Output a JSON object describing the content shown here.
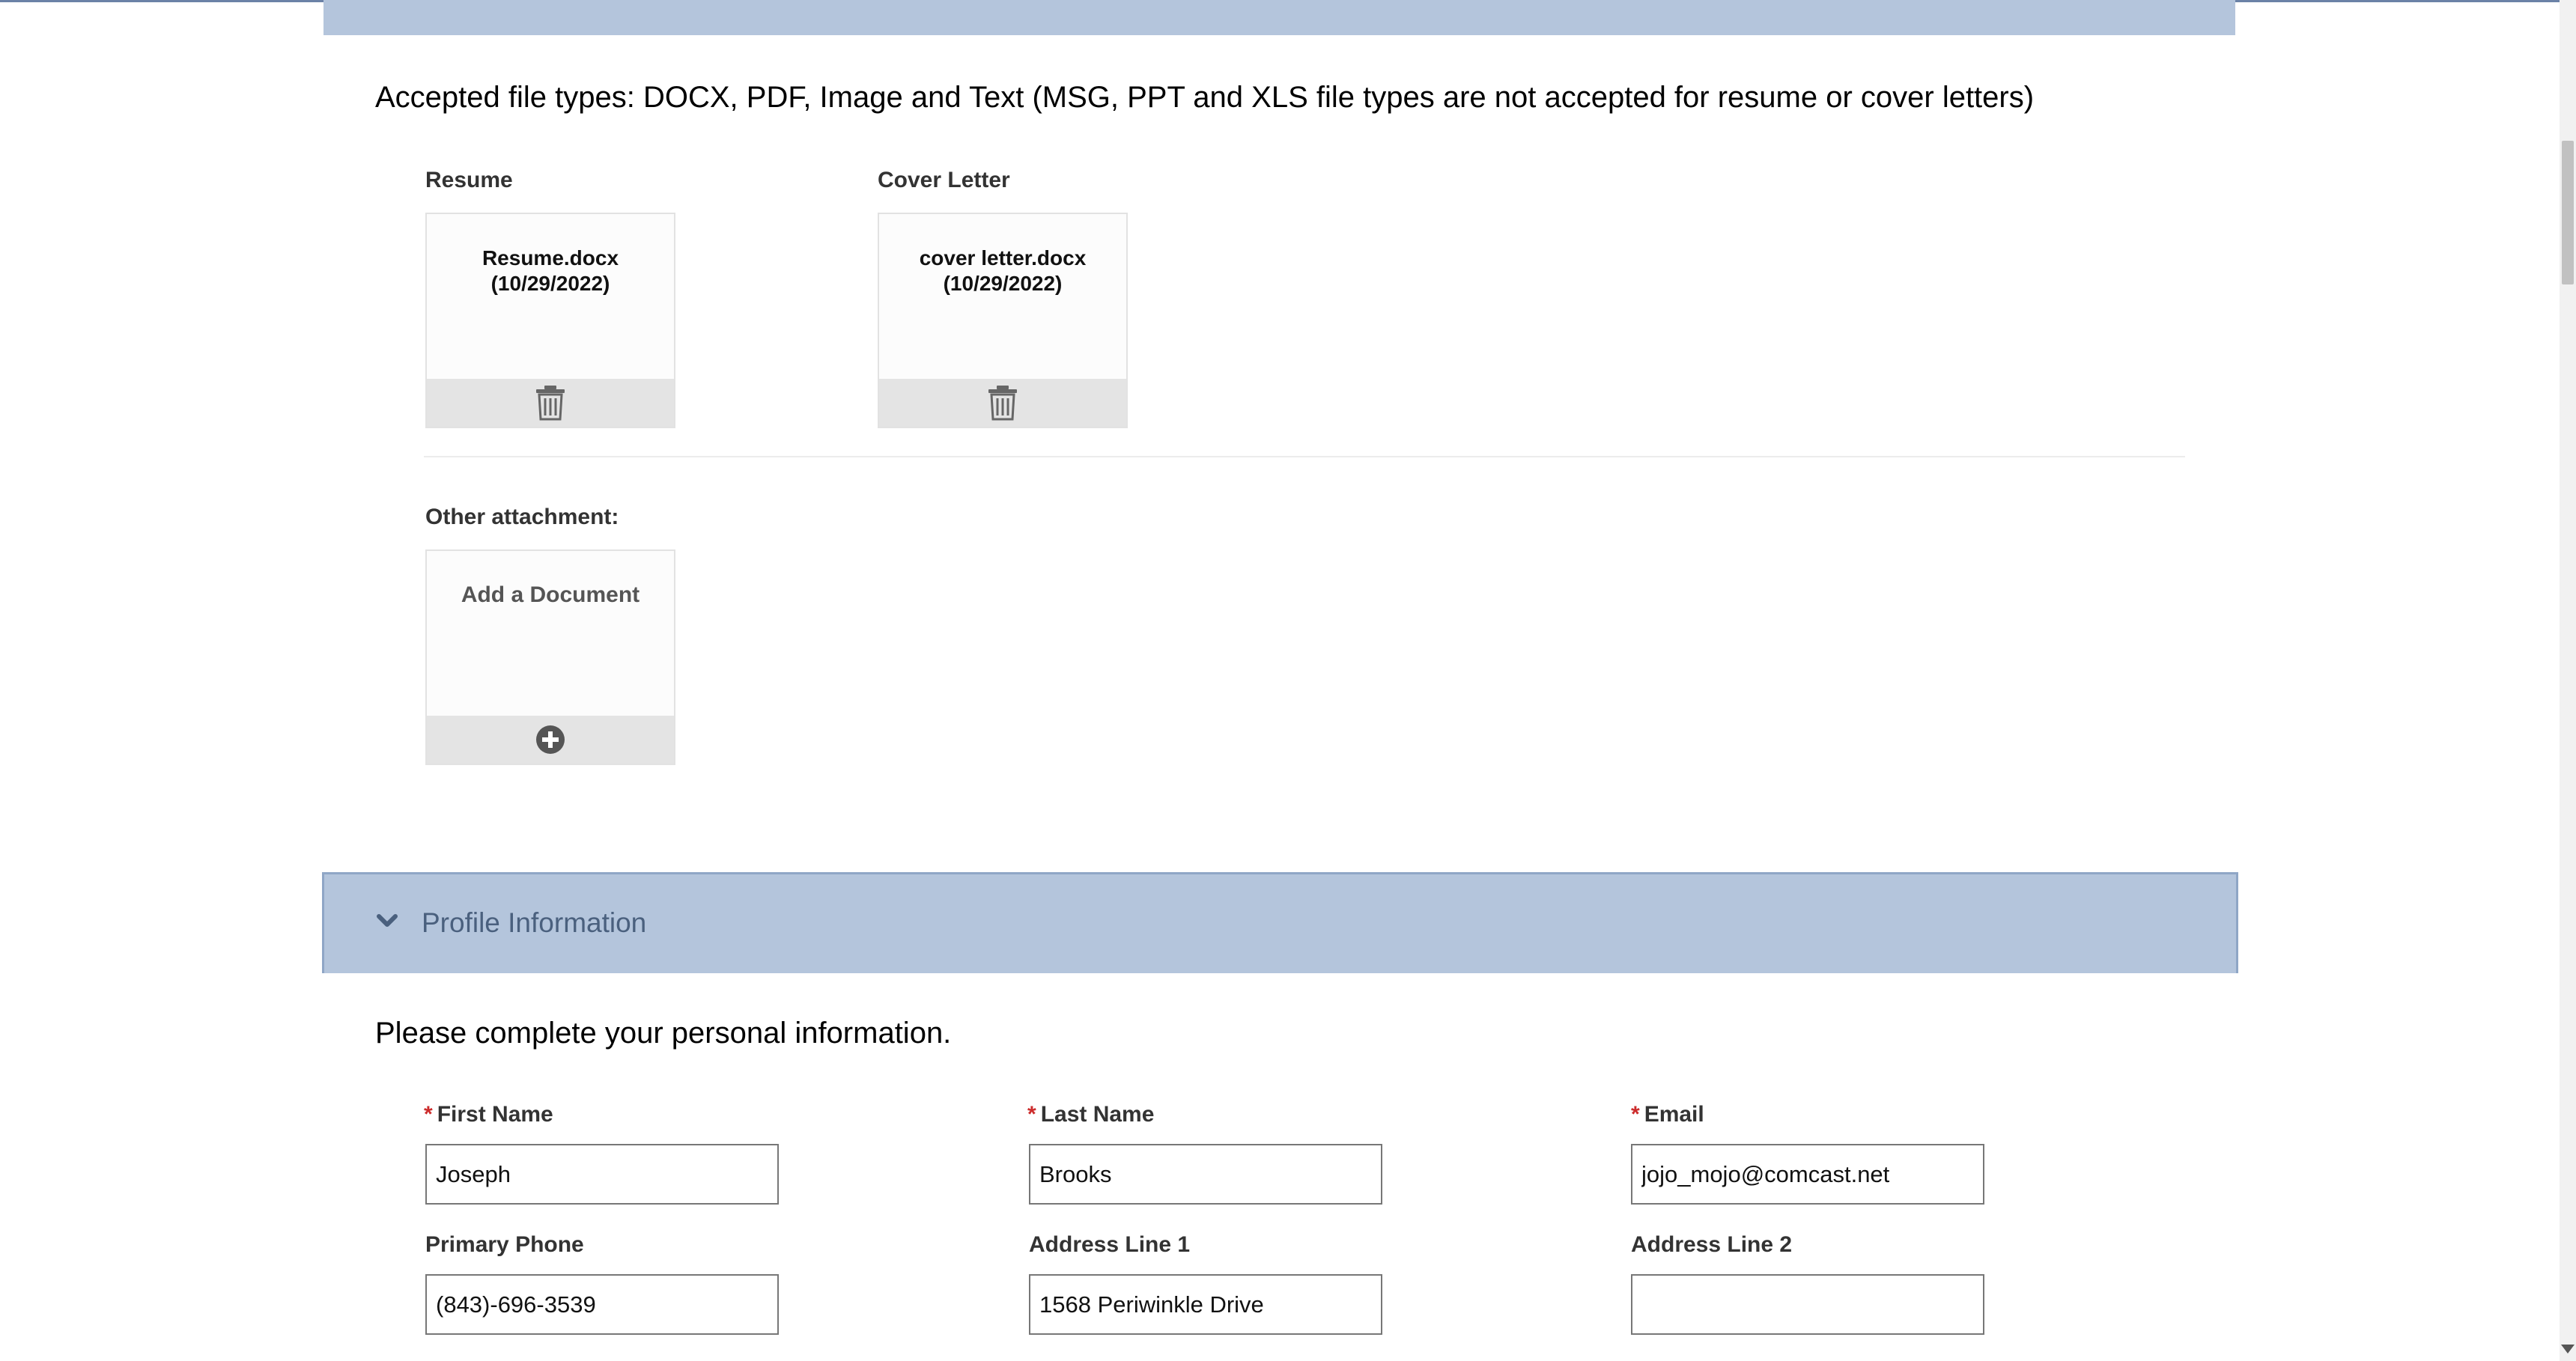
{
  "attachments": {
    "accepted_text": "Accepted file types: DOCX, PDF, Image and Text (MSG, PPT and XLS file types are not accepted for resume or cover letters)",
    "resume": {
      "label": "Resume",
      "file_name": "Resume.docx",
      "file_date": "(10/29/2022)",
      "action_icon": "trash-icon"
    },
    "cover_letter": {
      "label": "Cover Letter",
      "file_name": "cover letter.docx",
      "file_date": "(10/29/2022)",
      "action_icon": "trash-icon"
    },
    "other": {
      "label": "Other attachment:",
      "add_text": "Add a Document",
      "action_icon": "plus-circle-icon"
    }
  },
  "profile": {
    "section_title": "Profile Information",
    "section_icon": "chevron-down-icon",
    "instructions": "Please complete your personal information.",
    "required_marker": "*",
    "fields": {
      "first_name": {
        "label": "First Name",
        "required": true,
        "value": "Joseph"
      },
      "last_name": {
        "label": "Last Name",
        "required": true,
        "value": "Brooks"
      },
      "email": {
        "label": "Email",
        "required": true,
        "value": "jojo_mojo@comcast.net"
      },
      "primary_phone": {
        "label": "Primary Phone",
        "required": false,
        "value": "(843)-696-3539"
      },
      "address_line_1": {
        "label": "Address Line 1",
        "required": false,
        "value": "1568 Periwinkle Drive"
      },
      "address_line_2": {
        "label": "Address Line 2",
        "required": false,
        "value": ""
      }
    }
  },
  "colors": {
    "section_bar": "#b4c5dc",
    "section_title": "#4a607e",
    "required": "#cc2b2b"
  }
}
